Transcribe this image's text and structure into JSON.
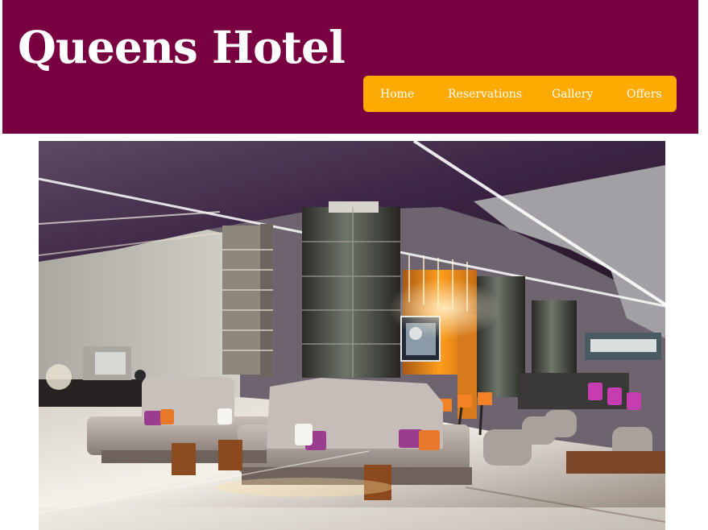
{
  "site": {
    "title": "Queens Hotel"
  },
  "nav": {
    "items": [
      {
        "label": "Home"
      },
      {
        "label": "Reservations"
      },
      {
        "label": "Gallery"
      },
      {
        "label": "Offers"
      }
    ]
  },
  "hero": {
    "image_subject": "hotel lobby interior"
  },
  "colors": {
    "header_background": "#780041",
    "nav_background": "#ffaa00",
    "text": "#ffffff"
  }
}
